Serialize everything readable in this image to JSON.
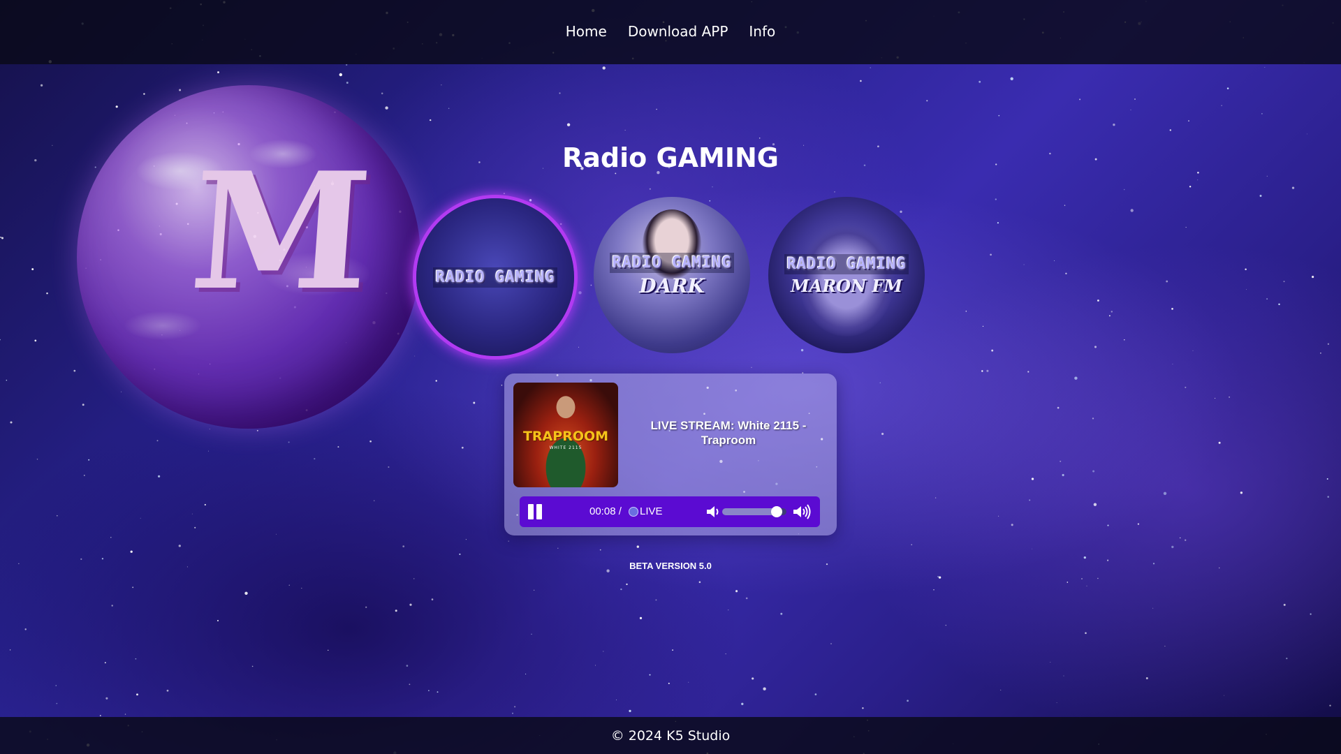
{
  "nav": {
    "items": [
      {
        "label": "Home"
      },
      {
        "label": "Download APP"
      },
      {
        "label": "Info"
      }
    ]
  },
  "logo": {
    "letter": "M"
  },
  "title": "Radio GAMING",
  "stations": [
    {
      "name": "RADIO GAMING",
      "sub": "",
      "active": true
    },
    {
      "name": "RADIO GAMING",
      "sub": "DARK",
      "active": false
    },
    {
      "name": "RADIO GAMING",
      "sub": "MARON FM",
      "active": false
    }
  ],
  "player": {
    "cover": {
      "title": "TRAPROOM",
      "artist": "WHITE 2115"
    },
    "now_playing": "LIVE STREAM: White 2115 - Traproom",
    "time": "00:08 /",
    "live_label": "LIVE",
    "volume": 0.85,
    "accent_color": "#5b0bd2",
    "icons": {
      "play_pause": "pause-icon",
      "volume_low": "volume-low-icon",
      "volume_high": "volume-high-icon"
    }
  },
  "version": "BETA VERSION 5.0",
  "footer": {
    "copyright": "© 2024 K5 Studio"
  }
}
